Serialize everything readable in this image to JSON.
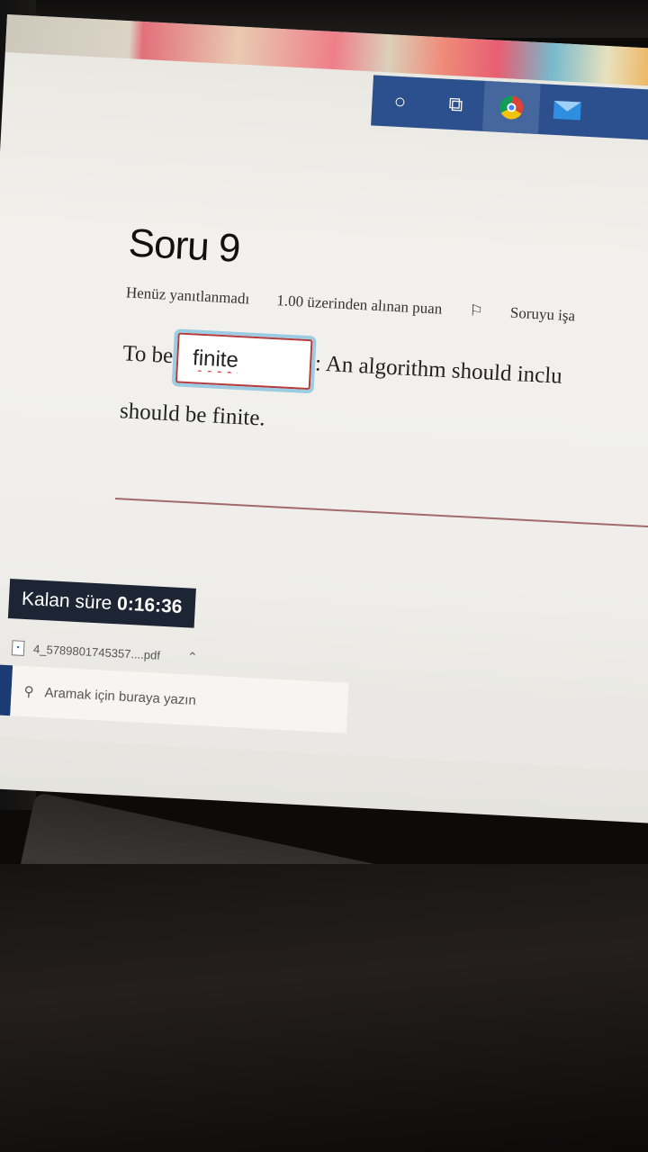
{
  "question": {
    "title": "Soru 9",
    "status": "Henüz yanıtlanmadı",
    "points": "1.00 üzerinden alınan puan",
    "flag_label": "Soruyu işa",
    "text_before": "To be",
    "answer_value": "finite",
    "text_after": ": An algorithm should inclu",
    "text_second_line": "should be finite."
  },
  "timer": {
    "label": "Kalan süre",
    "value": "0:16:36"
  },
  "download": {
    "filename": "4_5789801745357....pdf"
  },
  "taskbar": {
    "search_placeholder": "Aramak için buraya yazın"
  },
  "icons": {
    "flag": "flag-icon",
    "search": "search-icon",
    "windows": "windows-icon",
    "cortana": "cortana-icon",
    "task_view": "task-view-icon",
    "chrome": "chrome-icon",
    "mail": "mail-icon",
    "pdf": "pdf-file-icon"
  },
  "colors": {
    "timer_bg": "#1d2433",
    "taskbar_apps_bg": "#2c4f8d",
    "input_border": "#b83a3a",
    "input_focus": "#9ccbe2"
  }
}
